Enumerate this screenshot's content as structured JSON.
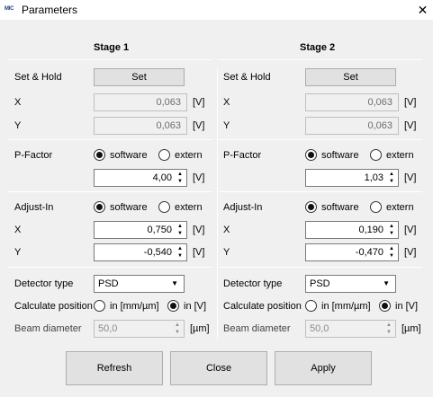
{
  "window": {
    "title": "Parameters",
    "app_icon_text": "MIC"
  },
  "stages": [
    {
      "title": "Stage 1",
      "set_hold": {
        "label": "Set & Hold",
        "button": "Set"
      },
      "x": {
        "label": "X",
        "value": "0,063",
        "unit": "[V]"
      },
      "y": {
        "label": "Y",
        "value": "0,063",
        "unit": "[V]"
      },
      "pfactor": {
        "label": "P-Factor",
        "opt_software": "software",
        "opt_extern": "extern",
        "selected": "software",
        "value": "4,00",
        "unit": "[V]"
      },
      "adjust": {
        "label": "Adjust-In",
        "opt_software": "software",
        "opt_extern": "extern",
        "selected": "software",
        "x_label": "X",
        "x_value": "0,750",
        "x_unit": "[V]",
        "y_label": "Y",
        "y_value": "-0,540",
        "y_unit": "[V]"
      },
      "detector": {
        "label": "Detector type",
        "value": "PSD"
      },
      "calc": {
        "label": "Calculate position",
        "opt1": "in [mm/µm]",
        "opt2": "in [V]",
        "selected": "in [V]"
      },
      "beam": {
        "label": "Beam diameter",
        "value": "50,0",
        "unit": "[µm]"
      }
    },
    {
      "title": "Stage 2",
      "set_hold": {
        "label": "Set & Hold",
        "button": "Set"
      },
      "x": {
        "label": "X",
        "value": "0,063",
        "unit": "[V]"
      },
      "y": {
        "label": "Y",
        "value": "0,063",
        "unit": "[V]"
      },
      "pfactor": {
        "label": "P-Factor",
        "opt_software": "software",
        "opt_extern": "extern",
        "selected": "software",
        "value": "1,03",
        "unit": "[V]"
      },
      "adjust": {
        "label": "Adjust-In",
        "opt_software": "software",
        "opt_extern": "extern",
        "selected": "software",
        "x_label": "X",
        "x_value": "0,190",
        "x_unit": "[V]",
        "y_label": "Y",
        "y_value": "-0,470",
        "y_unit": "[V]"
      },
      "detector": {
        "label": "Detector type",
        "value": "PSD"
      },
      "calc": {
        "label": "Calculate position",
        "opt1": "in [mm/µm]",
        "opt2": "in [V]",
        "selected": "in [V]"
      },
      "beam": {
        "label": "Beam diameter",
        "value": "50,0",
        "unit": "[µm]"
      }
    }
  ],
  "buttons": {
    "refresh": "Refresh",
    "close": "Close",
    "apply": "Apply"
  }
}
